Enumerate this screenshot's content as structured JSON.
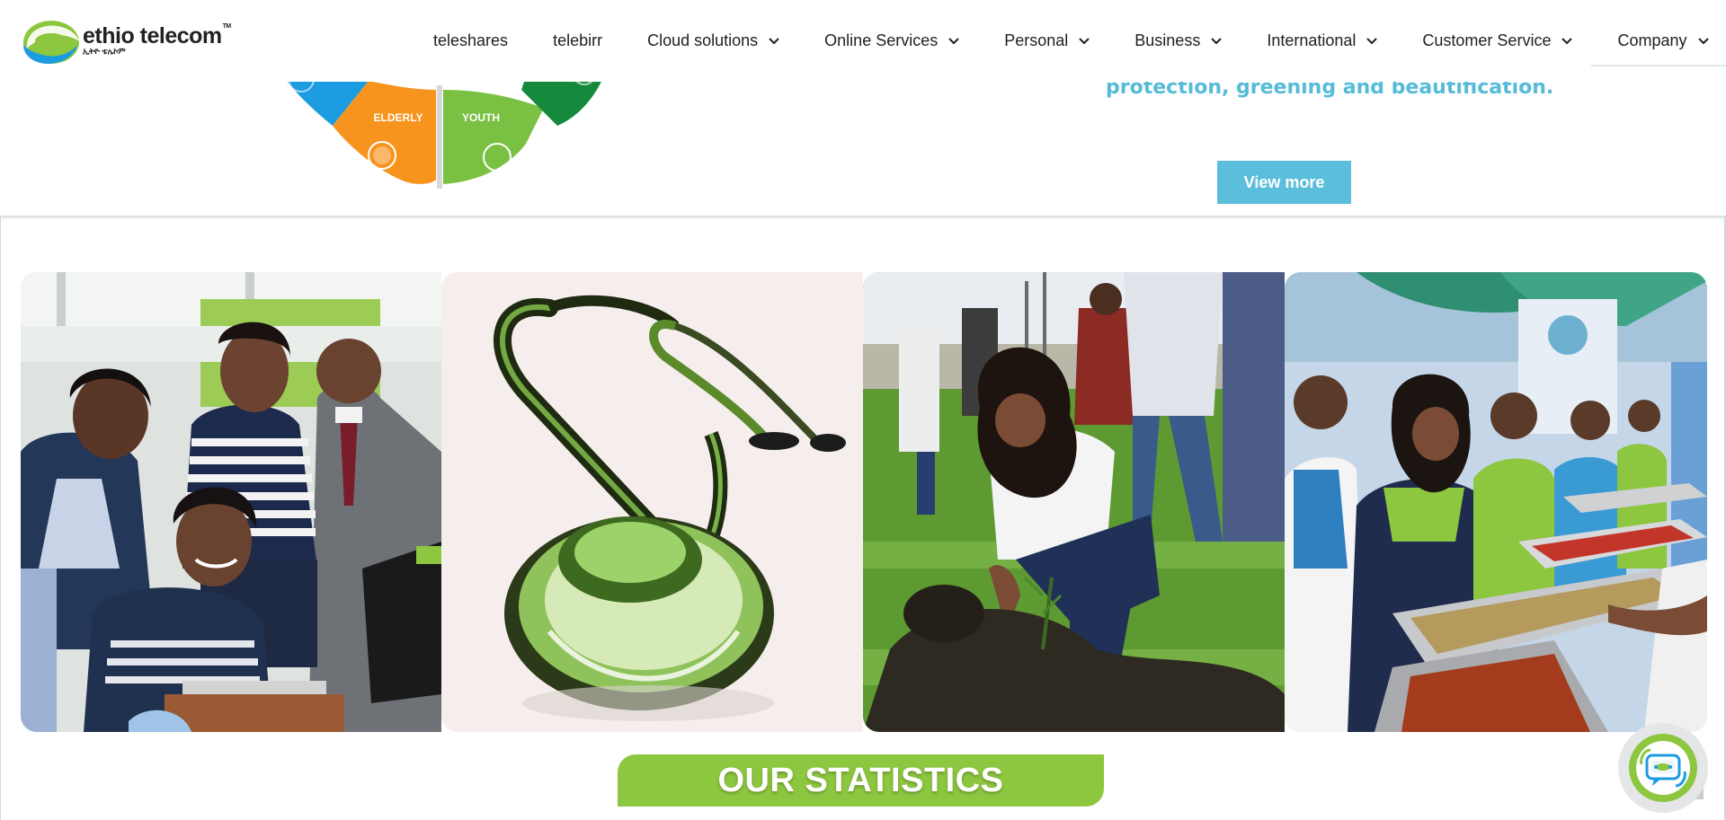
{
  "logo": {
    "brand": "ethio telecom",
    "trademark": "TM",
    "amharic": "ኢትዮ ቴሌኮም"
  },
  "nav": {
    "items": [
      {
        "label": "teleshares",
        "has_dropdown": false
      },
      {
        "label": "telebirr",
        "has_dropdown": false
      },
      {
        "label": "Cloud solutions",
        "has_dropdown": true
      },
      {
        "label": "Online Services",
        "has_dropdown": true
      },
      {
        "label": "Personal",
        "has_dropdown": true
      },
      {
        "label": "Business",
        "has_dropdown": true
      },
      {
        "label": "International",
        "has_dropdown": true
      },
      {
        "label": "Customer Service",
        "has_dropdown": true
      },
      {
        "label": "Company",
        "has_dropdown": true
      }
    ]
  },
  "banner": {
    "wheel_segments": [
      "ELDERLY",
      "YOUTH"
    ],
    "text_line": "protection, greening and beautification.",
    "view_more": "View more"
  },
  "photos": [
    {
      "name": "students-at-computer"
    },
    {
      "name": "green-stethoscope"
    },
    {
      "name": "tree-planting"
    },
    {
      "name": "food-serving"
    }
  ],
  "stats": {
    "title": "OUR STATISTICS"
  },
  "colors": {
    "brand_green": "#8dc63f",
    "brand_blue": "#5bbfdc",
    "text_dark": "#1f1f1f"
  }
}
